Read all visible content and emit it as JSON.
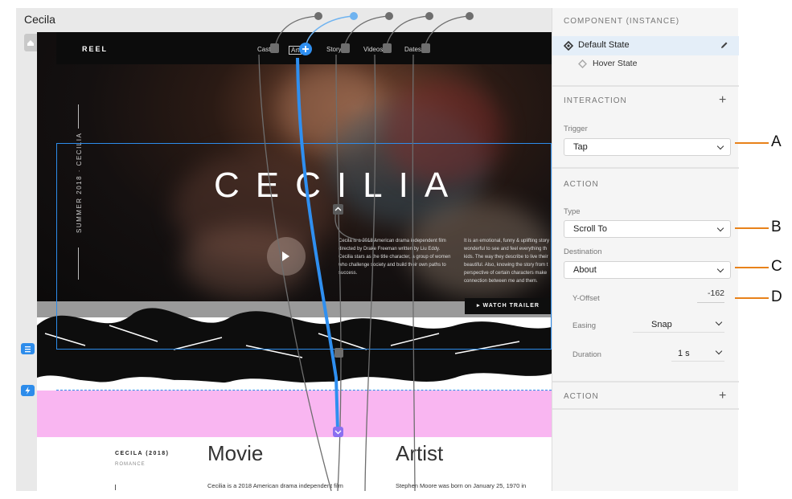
{
  "artboard": {
    "title": "Cecila"
  },
  "site": {
    "brand": "REEL",
    "nav": [
      "Cast",
      "Art",
      "Story",
      "Videos",
      "Dates"
    ],
    "side_text": "SUMMER 2018 · CECILIA",
    "hero_title": "CECILIA",
    "para_left": [
      "Cecila is a 2018 American drama independent film",
      "directed by Drake Freeman written by Liu Eddy.",
      "Cecilia stars as the title character, a group of women",
      "who challenge society and build their own paths to",
      "success."
    ],
    "para_right": [
      "It is an emotional, funny & uplifting story",
      "wonderful to see and feel everything th",
      "kids. The way they describe to live their",
      "beautiful. Also, knowing the story from t",
      "perspective of certain characters make",
      "connection between me and them."
    ],
    "watch_trailer": "WATCH TRAILER",
    "movie_label": "CECILA (2018)",
    "movie_genre": "ROMANCE",
    "movie_heading": "Movie",
    "artist_heading": "Artist",
    "movie_text": "Cecilia is a 2018 American drama independent film",
    "artist_text": "Stephen Moore was born on January 25, 1970 in"
  },
  "panel": {
    "component_header": "COMPONENT (INSTANCE)",
    "states": [
      "Default State",
      "Hover State"
    ],
    "interaction_header": "INTERACTION",
    "trigger_label": "Trigger",
    "trigger_value": "Tap",
    "action_header": "ACTION",
    "type_label": "Type",
    "type_value": "Scroll To",
    "destination_label": "Destination",
    "destination_value": "About",
    "yoffset_label": "Y-Offset",
    "yoffset_value": "-162",
    "easing_label": "Easing",
    "easing_value": "Snap",
    "duration_label": "Duration",
    "duration_value": "1 s",
    "action2_header": "ACTION"
  },
  "callouts": [
    "A",
    "B",
    "C",
    "D"
  ],
  "colors": {
    "accent": "#2d8ceb",
    "callout": "#e8821a",
    "pink": "#f9b6f1",
    "wire_grey": "#6e6e6e",
    "wire_blue": "#2f8ff0"
  },
  "icons": {
    "home": "home-icon",
    "pencil": "pencil-icon",
    "component": "component-diamond-icon",
    "plus": "plus-icon",
    "chevron": "chevron-down-icon",
    "lightning": "lightning-icon",
    "lines": "lines-icon",
    "play": "play-icon"
  }
}
